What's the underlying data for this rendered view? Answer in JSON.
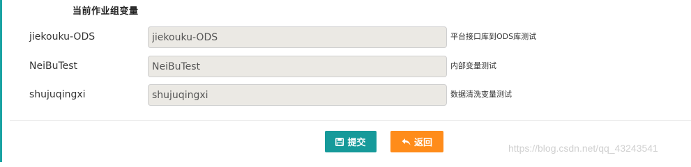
{
  "section": {
    "title": "当前作业组变量"
  },
  "variables": [
    {
      "name": "jiekouku-ODS",
      "value": "jiekouku-ODS",
      "description": "平台接口库到ODS库测试"
    },
    {
      "name": "NeiBuTest",
      "value": "NeiBuTest",
      "description": "内部变量测试"
    },
    {
      "name": "shujuqingxi",
      "value": "shujuqingxi",
      "description": "数据清洗变量测试"
    }
  ],
  "actions": {
    "submit_label": "提交",
    "back_label": "返回",
    "submit_icon": "save-icon",
    "back_icon": "reply-icon",
    "submit_color": "#169a9a",
    "back_color": "#ff8c1a"
  },
  "watermark": {
    "text": "https://blog.csdn.net/qq_43243541"
  }
}
